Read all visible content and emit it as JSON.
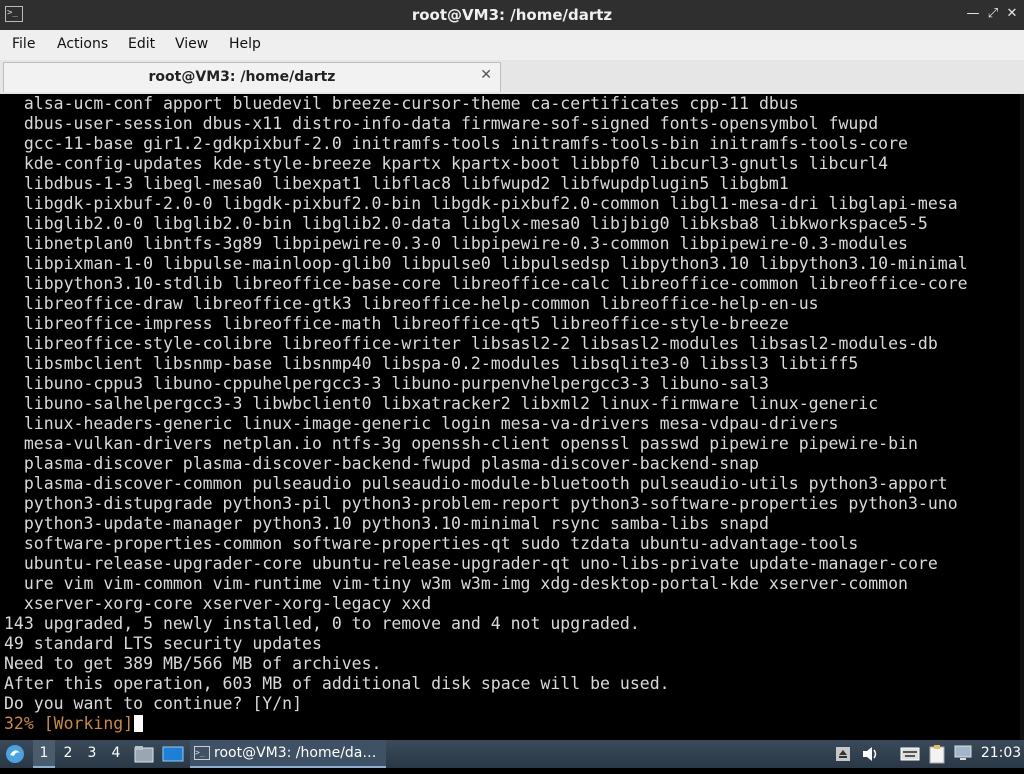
{
  "window": {
    "title": "root@VM3: /home/dartz",
    "app_icon_glyph": ">_",
    "minimize_glyph": "—",
    "maximize_glyph": "⤢",
    "close_glyph": "✕"
  },
  "menu": {
    "file": "File",
    "actions": "Actions",
    "edit": "Edit",
    "view": "View",
    "help": "Help"
  },
  "tab": {
    "label": "root@VM3: /home/dartz",
    "close_glyph": "✕"
  },
  "terminal": {
    "lines": [
      "  alsa-ucm-conf apport bluedevil breeze-cursor-theme ca-certificates cpp-11 dbus",
      "  dbus-user-session dbus-x11 distro-info-data firmware-sof-signed fonts-opensymbol fwupd",
      "  gcc-11-base gir1.2-gdkpixbuf-2.0 initramfs-tools initramfs-tools-bin initramfs-tools-core",
      "  kde-config-updates kde-style-breeze kpartx kpartx-boot libbpf0 libcurl3-gnutls libcurl4",
      "  libdbus-1-3 libegl-mesa0 libexpat1 libflac8 libfwupd2 libfwupdplugin5 libgbm1",
      "  libgdk-pixbuf-2.0-0 libgdk-pixbuf2.0-bin libgdk-pixbuf2.0-common libgl1-mesa-dri libglapi-mesa",
      "  libglib2.0-0 libglib2.0-bin libglib2.0-data libglx-mesa0 libjbig0 libksba8 libkworkspace5-5",
      "  libnetplan0 libntfs-3g89 libpipewire-0.3-0 libpipewire-0.3-common libpipewire-0.3-modules",
      "  libpixman-1-0 libpulse-mainloop-glib0 libpulse0 libpulsedsp libpython3.10 libpython3.10-minimal",
      "  libpython3.10-stdlib libreoffice-base-core libreoffice-calc libreoffice-common libreoffice-core",
      "  libreoffice-draw libreoffice-gtk3 libreoffice-help-common libreoffice-help-en-us",
      "  libreoffice-impress libreoffice-math libreoffice-qt5 libreoffice-style-breeze",
      "  libreoffice-style-colibre libreoffice-writer libsasl2-2 libsasl2-modules libsasl2-modules-db",
      "  libsmbclient libsnmp-base libsnmp40 libspa-0.2-modules libsqlite3-0 libssl3 libtiff5",
      "  libuno-cppu3 libuno-cppuhelpergcc3-3 libuno-purpenvhelpergcc3-3 libuno-sal3",
      "  libuno-salhelpergcc3-3 libwbclient0 libxatracker2 libxml2 linux-firmware linux-generic",
      "  linux-headers-generic linux-image-generic login mesa-va-drivers mesa-vdpau-drivers",
      "  mesa-vulkan-drivers netplan.io ntfs-3g openssh-client openssl passwd pipewire pipewire-bin",
      "  plasma-discover plasma-discover-backend-fwupd plasma-discover-backend-snap",
      "  plasma-discover-common pulseaudio pulseaudio-module-bluetooth pulseaudio-utils python3-apport",
      "  python3-distupgrade python3-pil python3-problem-report python3-software-properties python3-uno",
      "  python3-update-manager python3.10 python3.10-minimal rsync samba-libs snapd",
      "  software-properties-common software-properties-qt sudo tzdata ubuntu-advantage-tools",
      "  ubuntu-release-upgrader-core ubuntu-release-upgrader-qt uno-libs-private update-manager-core",
      "  ure vim vim-common vim-runtime vim-tiny w3m w3m-img xdg-desktop-portal-kde xserver-common",
      "  xserver-xorg-core xserver-xorg-legacy xxd",
      "143 upgraded, 5 newly installed, 0 to remove and 4 not upgraded.",
      "49 standard LTS security updates",
      "Need to get 389 MB/566 MB of archives.",
      "After this operation, 603 MB of additional disk space will be used.",
      "Do you want to continue? [Y/n]"
    ],
    "progress_line": "32% [Working]",
    "progress_percent": 32
  },
  "taskbar": {
    "workspaces": [
      "1",
      "2",
      "3",
      "4"
    ],
    "active_workspace": "1",
    "task_label": "root@VM3: /home/da…",
    "clock": "21:03"
  },
  "colors": {
    "terminal_bg": "#000000",
    "terminal_fg": "#d9d9d9",
    "progress_text": "#c98a3c",
    "titlebar_bg": "#2f2f2f",
    "taskbar_bg": "#2a3846"
  }
}
